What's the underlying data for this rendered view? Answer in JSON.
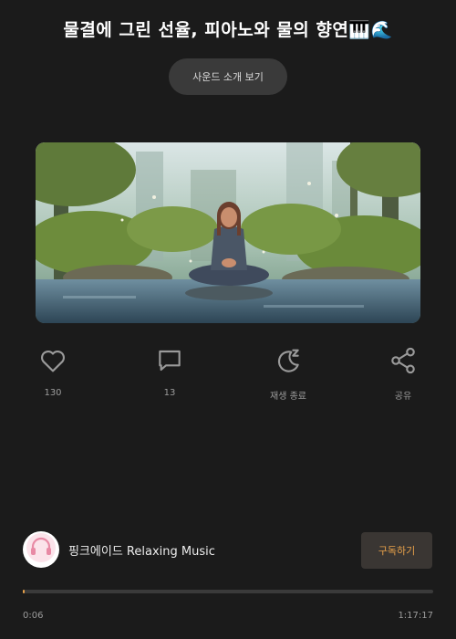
{
  "title": "물결에 그린 선율, 피아노와 물의 향연🎹🌊",
  "intro_button": "사운드 소개 보기",
  "actions": [
    {
      "icon": "heart-icon",
      "label": "130"
    },
    {
      "icon": "comment-icon",
      "label": "13"
    },
    {
      "icon": "sleep-timer-icon",
      "label": "재생 종료"
    },
    {
      "icon": "share-icon",
      "label": "공유"
    }
  ],
  "channel": {
    "name": "핑크에이드 Relaxing Music",
    "avatar_icon": "headphones-icon",
    "subscribe_label": "구독하기"
  },
  "player": {
    "current_time": "0:06",
    "total_time": "1:17:17",
    "progress": 0.001
  },
  "colors": {
    "background": "#1b1b1b",
    "accent": "#e6a04a",
    "button_bg": "#3a3a3a"
  }
}
